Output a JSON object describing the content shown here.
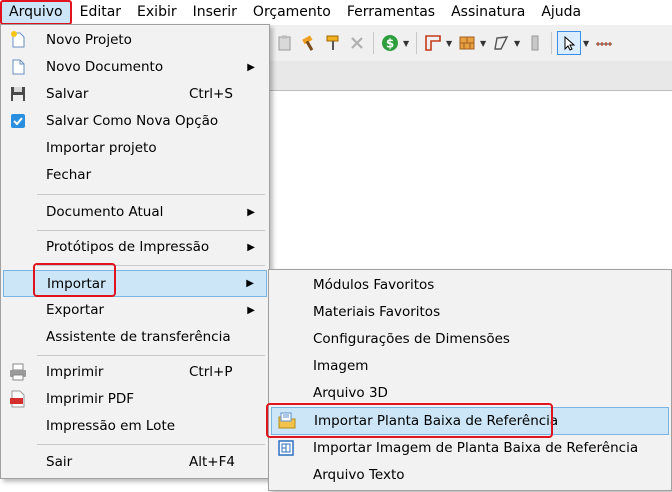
{
  "menubar": {
    "items": [
      "Arquivo",
      "Editar",
      "Exibir",
      "Inserir",
      "Orçamento",
      "Ferramentas",
      "Assinatura",
      "Ajuda"
    ]
  },
  "file_menu": {
    "items": [
      {
        "label": "Novo Projeto",
        "icon": "new-project-icon"
      },
      {
        "label": "Novo Documento",
        "submenu": true,
        "icon": "document-icon"
      },
      {
        "label": "Salvar",
        "shortcut": "Ctrl+S",
        "icon": "floppy-disk-icon"
      },
      {
        "label": "Salvar Como Nova Opção",
        "icon": "save-check-icon"
      },
      {
        "label": "Importar projeto"
      },
      {
        "label": "Fechar"
      },
      {
        "label": "Documento Atual",
        "submenu": true
      },
      {
        "label": "Protótipos de Impressão",
        "submenu": true
      },
      {
        "label": "Importar",
        "submenu": true,
        "highlighted": true
      },
      {
        "label": "Exportar",
        "submenu": true
      },
      {
        "label": "Assistente de transferência"
      },
      {
        "label": "Imprimir",
        "shortcut": "Ctrl+P",
        "icon": "printer-icon"
      },
      {
        "label": "Imprimir PDF",
        "icon": "pdf-icon"
      },
      {
        "label": "Impressão em Lote"
      },
      {
        "label": "Sair",
        "shortcut": "Alt+F4"
      }
    ],
    "arrow": "▶"
  },
  "import_submenu": {
    "items": [
      {
        "label": "Módulos Favoritos"
      },
      {
        "label": "Materiais Favoritos"
      },
      {
        "label": "Configurações de Dimensões"
      },
      {
        "label": "Imagem"
      },
      {
        "label": "Arquivo 3D"
      },
      {
        "label": "Importar Planta Baixa de Referência",
        "highlighted": true,
        "icon": "floor-plan-import-icon"
      },
      {
        "label": "Importar Imagem de Planta Baixa de Referência",
        "icon": "floor-plan-image-icon"
      },
      {
        "label": "Arquivo Texto"
      }
    ]
  },
  "colors": {
    "highlight": "#cde6f7",
    "highlight_border": "#7ab4e2",
    "annotation_red": "#e0141e",
    "menu_bg": "#f2f2f2"
  }
}
